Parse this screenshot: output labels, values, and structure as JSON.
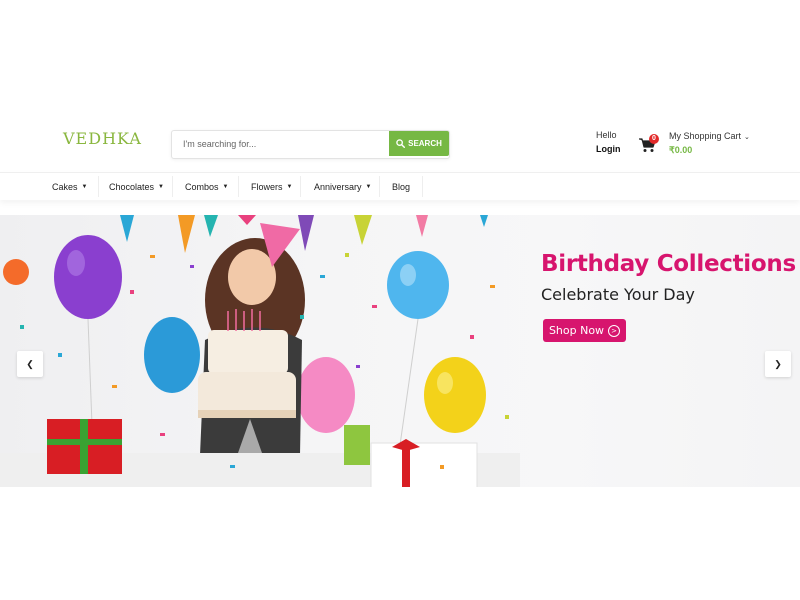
{
  "header": {
    "logo": "VEDHKA",
    "search": {
      "placeholder": "I'm searching for...",
      "value": "",
      "button_label": "SEARCH"
    },
    "account": {
      "greeting": "Hello",
      "login_label": "Login"
    },
    "cart": {
      "title": "My Shopping Cart",
      "count": "0",
      "total": "₹0.00"
    }
  },
  "nav": {
    "items": [
      {
        "label": "Cakes",
        "has_caret": true
      },
      {
        "label": "Chocolates",
        "has_caret": true
      },
      {
        "label": "Combos",
        "has_caret": true
      },
      {
        "label": "Flowers",
        "has_caret": true
      },
      {
        "label": "Anniversary",
        "has_caret": true
      },
      {
        "label": "Blog",
        "has_caret": false
      }
    ],
    "caret_glyph": "▼"
  },
  "banner": {
    "title": "Birthday Collections",
    "subtitle": "Celebrate Your Day",
    "cta_label": "Shop Now",
    "prev_glyph": "❮",
    "next_glyph": "❯"
  },
  "colors": {
    "brand_green": "#76b844",
    "logo_green": "#8ab73f",
    "banner_pink": "#d7156e",
    "badge_red": "#e22929"
  },
  "icons": {
    "search_button": "search-icon",
    "cart": "shopping-cart-icon",
    "cta": "circle-arrow-right-icon",
    "prev": "chevron-left-icon",
    "next": "chevron-right-icon"
  }
}
